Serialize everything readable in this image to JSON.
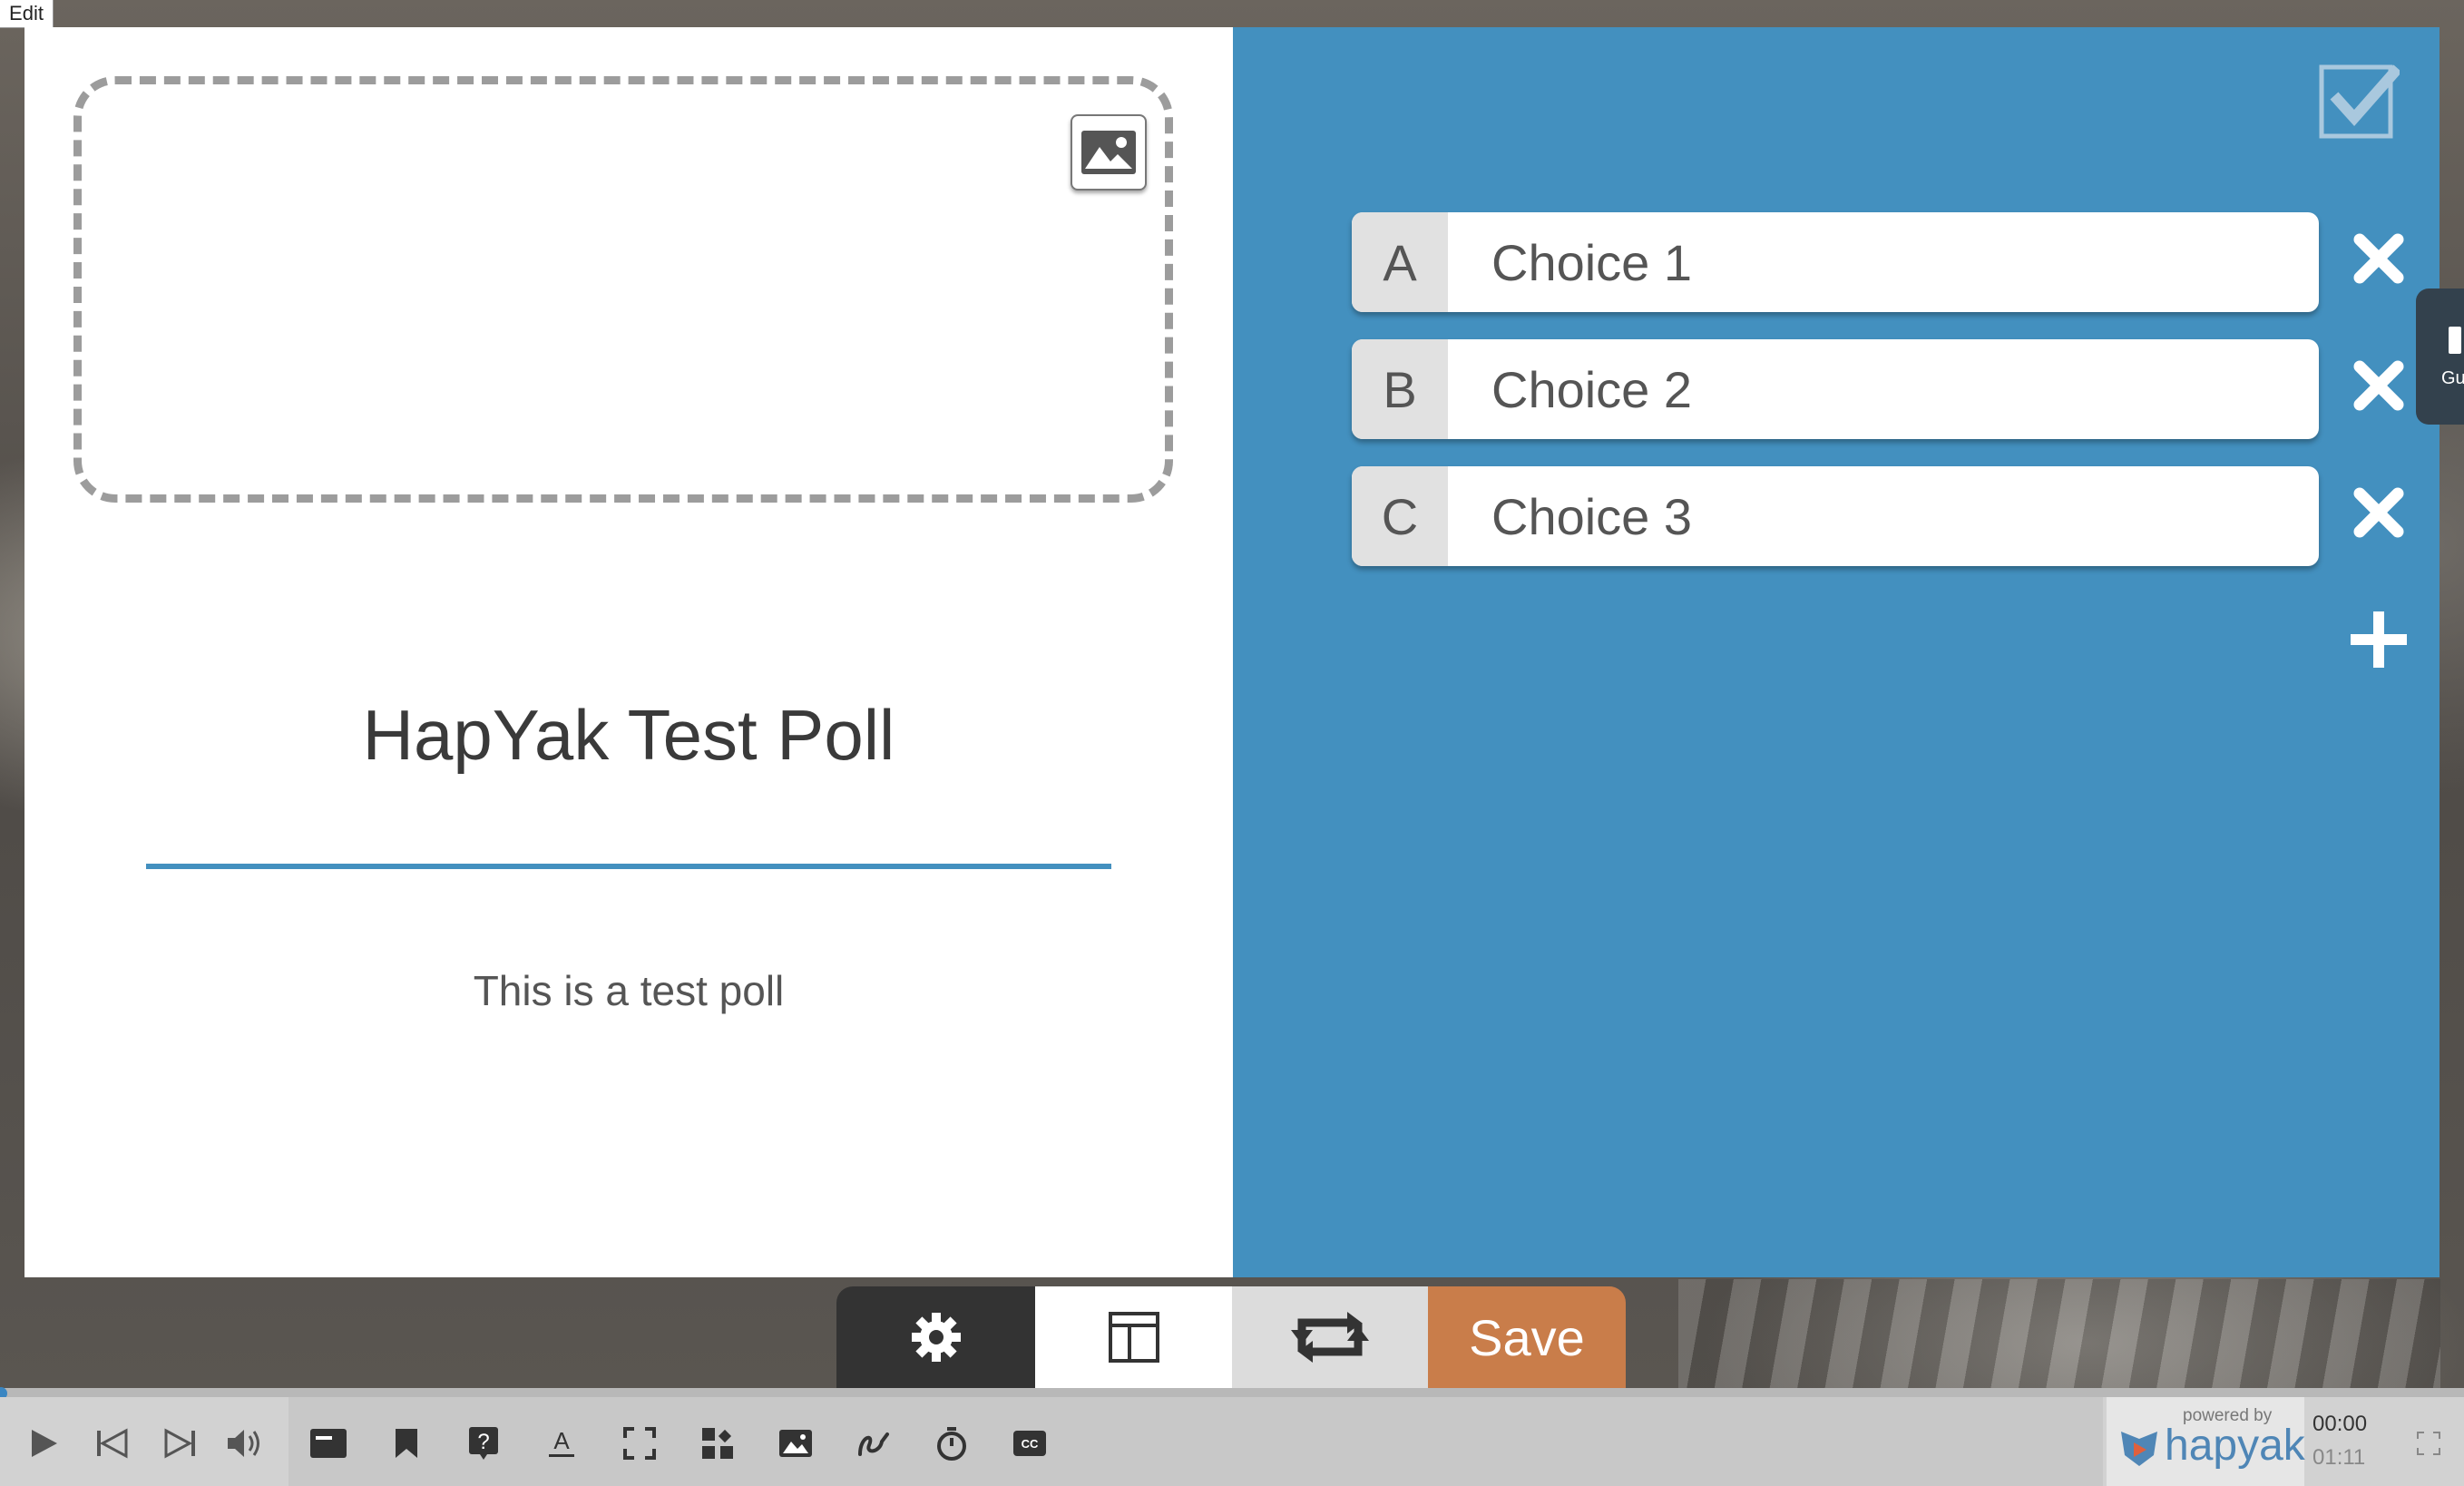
{
  "window": {
    "edit_tab": "Edit"
  },
  "poll": {
    "title": "HapYak Test Poll",
    "description": "This is a test poll"
  },
  "choices": [
    {
      "letter": "A",
      "label": "Choice 1"
    },
    {
      "letter": "B",
      "label": "Choice 2"
    },
    {
      "letter": "C",
      "label": "Choice 3"
    }
  ],
  "side_tab": {
    "label": "Gu"
  },
  "editor_toolbar": {
    "save_label": "Save"
  },
  "player": {
    "powered_by": "powered by",
    "brand": "hapyak",
    "current_time": "00:00",
    "total_time": "01:11",
    "progress": 0
  },
  "icons": {
    "image": "image-icon",
    "check": "check-icon",
    "remove": "close-icon",
    "add": "plus-icon",
    "settings": "gear-icon",
    "layout": "layout-icon",
    "swap": "retweet-icon",
    "play": "play-icon",
    "prev": "skip-back-icon",
    "next": "skip-forward-icon",
    "volume": "volume-icon",
    "text": "text-annotation-icon",
    "bookmark": "bookmark-icon",
    "question": "question-icon",
    "underline": "underline-text-icon",
    "fullscreen-region": "crop-icon",
    "widgets": "widgets-icon",
    "picture": "picture-icon",
    "draw": "draw-icon",
    "timer": "timer-icon",
    "cc": "closed-caption-icon",
    "expand": "fullscreen-icon"
  },
  "colors": {
    "accent": "#4390bf",
    "save": "#c97d4a",
    "brand": "#4f86b6"
  }
}
